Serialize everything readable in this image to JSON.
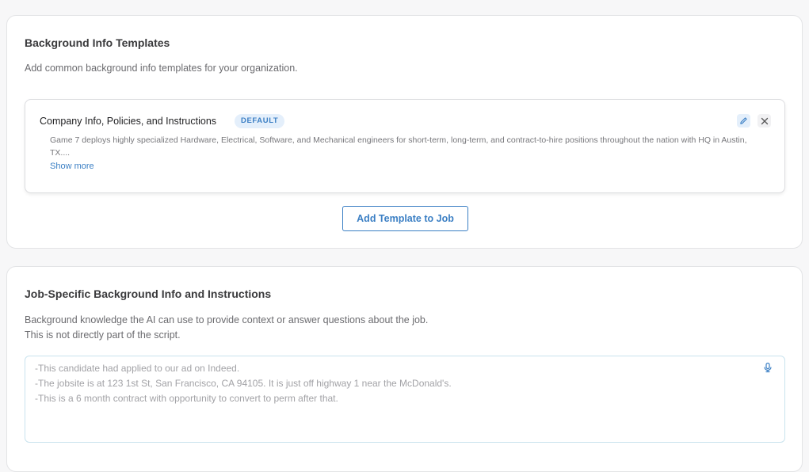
{
  "background_templates": {
    "title": "Background Info Templates",
    "description": "Add common background info templates for your organization.",
    "template": {
      "name": "Company Info, Policies, and Instructions",
      "badge": "DEFAULT",
      "body": "Game 7 deploys highly specialized Hardware, Electrical, Software, and Mechanical engineers for short-term, long-term, and contract-to-hire positions throughout the nation with HQ in Austin, TX....",
      "show_more": "Show more",
      "edit_icon": "pencil-icon",
      "close_icon": "close-icon"
    },
    "add_button": "Add Template to Job"
  },
  "job_specific": {
    "title": "Job-Specific Background Info and Instructions",
    "description_line1": "Background knowledge the AI can use to provide context or answer questions about the job.",
    "description_line2": "This is not directly part of the script.",
    "placeholder_lines": [
      "-This candidate had applied to our ad on Indeed.",
      "-The jobsite is at 123 1st St, San Francisco, CA 94105. It is just off highway 1 near the McDonald's.",
      "-This is a 6 month contract with opportunity to convert to perm after that."
    ],
    "mic_icon": "microphone-icon"
  },
  "colors": {
    "accent": "#3b7fc4",
    "badge_bg": "#e4effb",
    "text": "#3a3a3c",
    "muted": "#6b6b6f"
  }
}
